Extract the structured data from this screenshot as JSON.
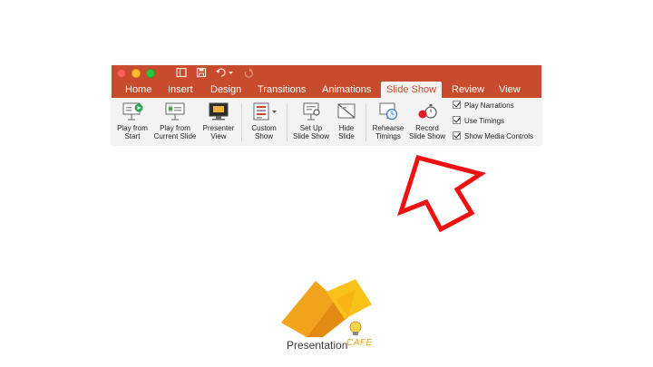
{
  "window": {
    "tabs": [
      {
        "label": "Home"
      },
      {
        "label": "Insert"
      },
      {
        "label": "Design"
      },
      {
        "label": "Transitions"
      },
      {
        "label": "Animations"
      },
      {
        "label": "Slide Show",
        "active": true
      },
      {
        "label": "Review"
      },
      {
        "label": "View"
      }
    ]
  },
  "toolbar": {
    "play_from_start": {
      "line1": "Play from",
      "line2": "Start"
    },
    "play_from_current": {
      "line1": "Play from",
      "line2": "Current Slide"
    },
    "presenter_view": {
      "line1": "Presenter",
      "line2": "View"
    },
    "custom_show": {
      "line1": "Custom",
      "line2": "Show"
    },
    "set_up_slide_show": {
      "line1": "Set Up",
      "line2": "Slide Show"
    },
    "hide_slide": {
      "line1": "Hide",
      "line2": "Slide"
    },
    "rehearse_timings": {
      "line1": "Rehearse",
      "line2": "Timings"
    },
    "record_slide_show": {
      "line1": "Record",
      "line2": "Slide Show"
    },
    "checkboxes": [
      {
        "label": "Play Narrations",
        "checked": true
      },
      {
        "label": "Use Timings",
        "checked": true
      },
      {
        "label": "Show Media Controls",
        "checked": true
      }
    ]
  },
  "annotation": {
    "arrow_color": "#ee1111"
  },
  "brand": {
    "name": "Presentation",
    "suffix": "CAFE",
    "colors": {
      "orange": "#f2a31c",
      "yellow": "#f9c21a"
    }
  },
  "theme": {
    "accent": "#c74b2c",
    "ribbon_bg": "#f3f3f3"
  }
}
